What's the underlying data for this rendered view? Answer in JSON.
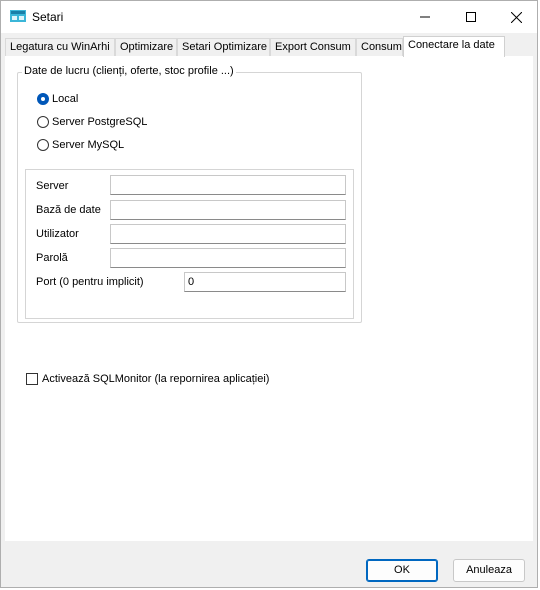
{
  "window": {
    "title": "Setari"
  },
  "tabs": [
    {
      "label": "Legatura cu WinArhi"
    },
    {
      "label": "Optimizare"
    },
    {
      "label": "Setari Optimizare"
    },
    {
      "label": "Export Consum"
    },
    {
      "label": "Consum"
    },
    {
      "label": "Conectare la date",
      "active": true
    }
  ],
  "data_group": {
    "legend": "Date de lucru (clienți, oferte, stoc profile ...)",
    "radios": [
      {
        "label": "Local",
        "checked": true
      },
      {
        "label": "Server PostgreSQL",
        "checked": false
      },
      {
        "label": "Server MySQL",
        "checked": false
      }
    ],
    "fields": {
      "server": {
        "label": "Server",
        "value": ""
      },
      "database": {
        "label": "Bază de date",
        "value": ""
      },
      "user": {
        "label": "Utilizator",
        "value": ""
      },
      "password": {
        "label": "Parolă",
        "value": ""
      },
      "port": {
        "label": "Port (0 pentru implicit)",
        "value": "0"
      }
    }
  },
  "sqlmonitor": {
    "label": "Activează SQLMonitor (la repornirea aplicației)",
    "checked": false
  },
  "buttons": {
    "ok": "OK",
    "cancel": "Anuleaza"
  },
  "colors": {
    "accent": "#0067c0",
    "radio_checked": "#0057b8"
  }
}
